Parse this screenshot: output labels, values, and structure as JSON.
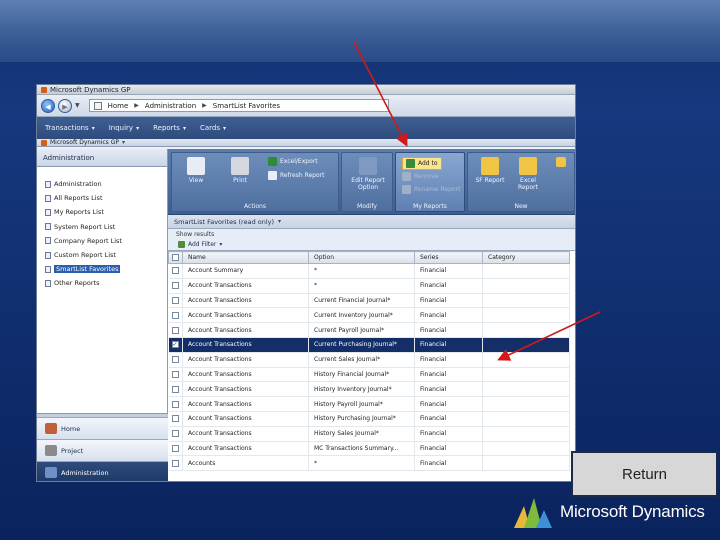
{
  "window": {
    "title": "Microsoft Dynamics GP"
  },
  "breadcrumbs": [
    "Home",
    "Administration",
    "SmartList Favorites"
  ],
  "menu": [
    "Transactions",
    "Inquiry",
    "Reports",
    "Cards"
  ],
  "company": "Microsoft Dynamics GP",
  "nav": {
    "header": "Administration",
    "items": [
      "Administration",
      "All Reports List",
      "My Reports List",
      "System Report List",
      "Company Report List",
      "Custom Report List",
      "SmartList Favorites",
      "Other Reports"
    ],
    "selected_index": 6,
    "bottom_buttons": [
      "Home",
      "Project",
      "Administration"
    ]
  },
  "ribbon": {
    "actions": {
      "label": "Actions",
      "view": "View",
      "print": "Print",
      "export": "Excel/Export",
      "refresh": "Refresh Report"
    },
    "modify": {
      "label": "Modify",
      "edit": "Edit Report Option"
    },
    "my_reports": {
      "label": "My Reports",
      "add_to": "Add to",
      "remove": "Remove",
      "rename": "Rename Report"
    },
    "new": {
      "label": "New",
      "sf": "SF Report",
      "excel": "Excel Report"
    }
  },
  "list": {
    "title": "SmartList Favorites (read only)",
    "subtitle": "Show results",
    "filter": "Add Filter",
    "columns": [
      "Name",
      "Option",
      "Series",
      "Category"
    ],
    "rows": [
      {
        "name": "Account Summary",
        "option": "*",
        "series": "Financial",
        "checked": false
      },
      {
        "name": "Account Transactions",
        "option": "*",
        "series": "Financial",
        "checked": false
      },
      {
        "name": "Account Transactions",
        "option": "Current Financial Journal*",
        "series": "Financial",
        "checked": false
      },
      {
        "name": "Account Transactions",
        "option": "Current Inventory Journal*",
        "series": "Financial",
        "checked": false
      },
      {
        "name": "Account Transactions",
        "option": "Current Payroll Journal*",
        "series": "Financial",
        "checked": false
      },
      {
        "name": "Account Transactions",
        "option": "Current Purchasing Journal*",
        "series": "Financial",
        "checked": true
      },
      {
        "name": "Account Transactions",
        "option": "Current Sales Journal*",
        "series": "Financial",
        "checked": false
      },
      {
        "name": "Account Transactions",
        "option": "History Financial Journal*",
        "series": "Financial",
        "checked": false
      },
      {
        "name": "Account Transactions",
        "option": "History Inventory Journal*",
        "series": "Financial",
        "checked": false
      },
      {
        "name": "Account Transactions",
        "option": "History Payroll Journal*",
        "series": "Financial",
        "checked": false
      },
      {
        "name": "Account Transactions",
        "option": "History Purchasing Journal*",
        "series": "Financial",
        "checked": false
      },
      {
        "name": "Account Transactions",
        "option": "History Sales Journal*",
        "series": "Financial",
        "checked": false
      },
      {
        "name": "Account Transactions",
        "option": "MC Transactions Summary...",
        "series": "Financial",
        "checked": false
      },
      {
        "name": "Accounts",
        "option": "*",
        "series": "Financial",
        "checked": false
      }
    ],
    "selected_index": 5
  },
  "return_label": "Return",
  "brand": "Microsoft Dynamics",
  "colors": {
    "arrow": "#d11919",
    "selection": "#142f68",
    "ribbon": "#4f6f9f"
  }
}
